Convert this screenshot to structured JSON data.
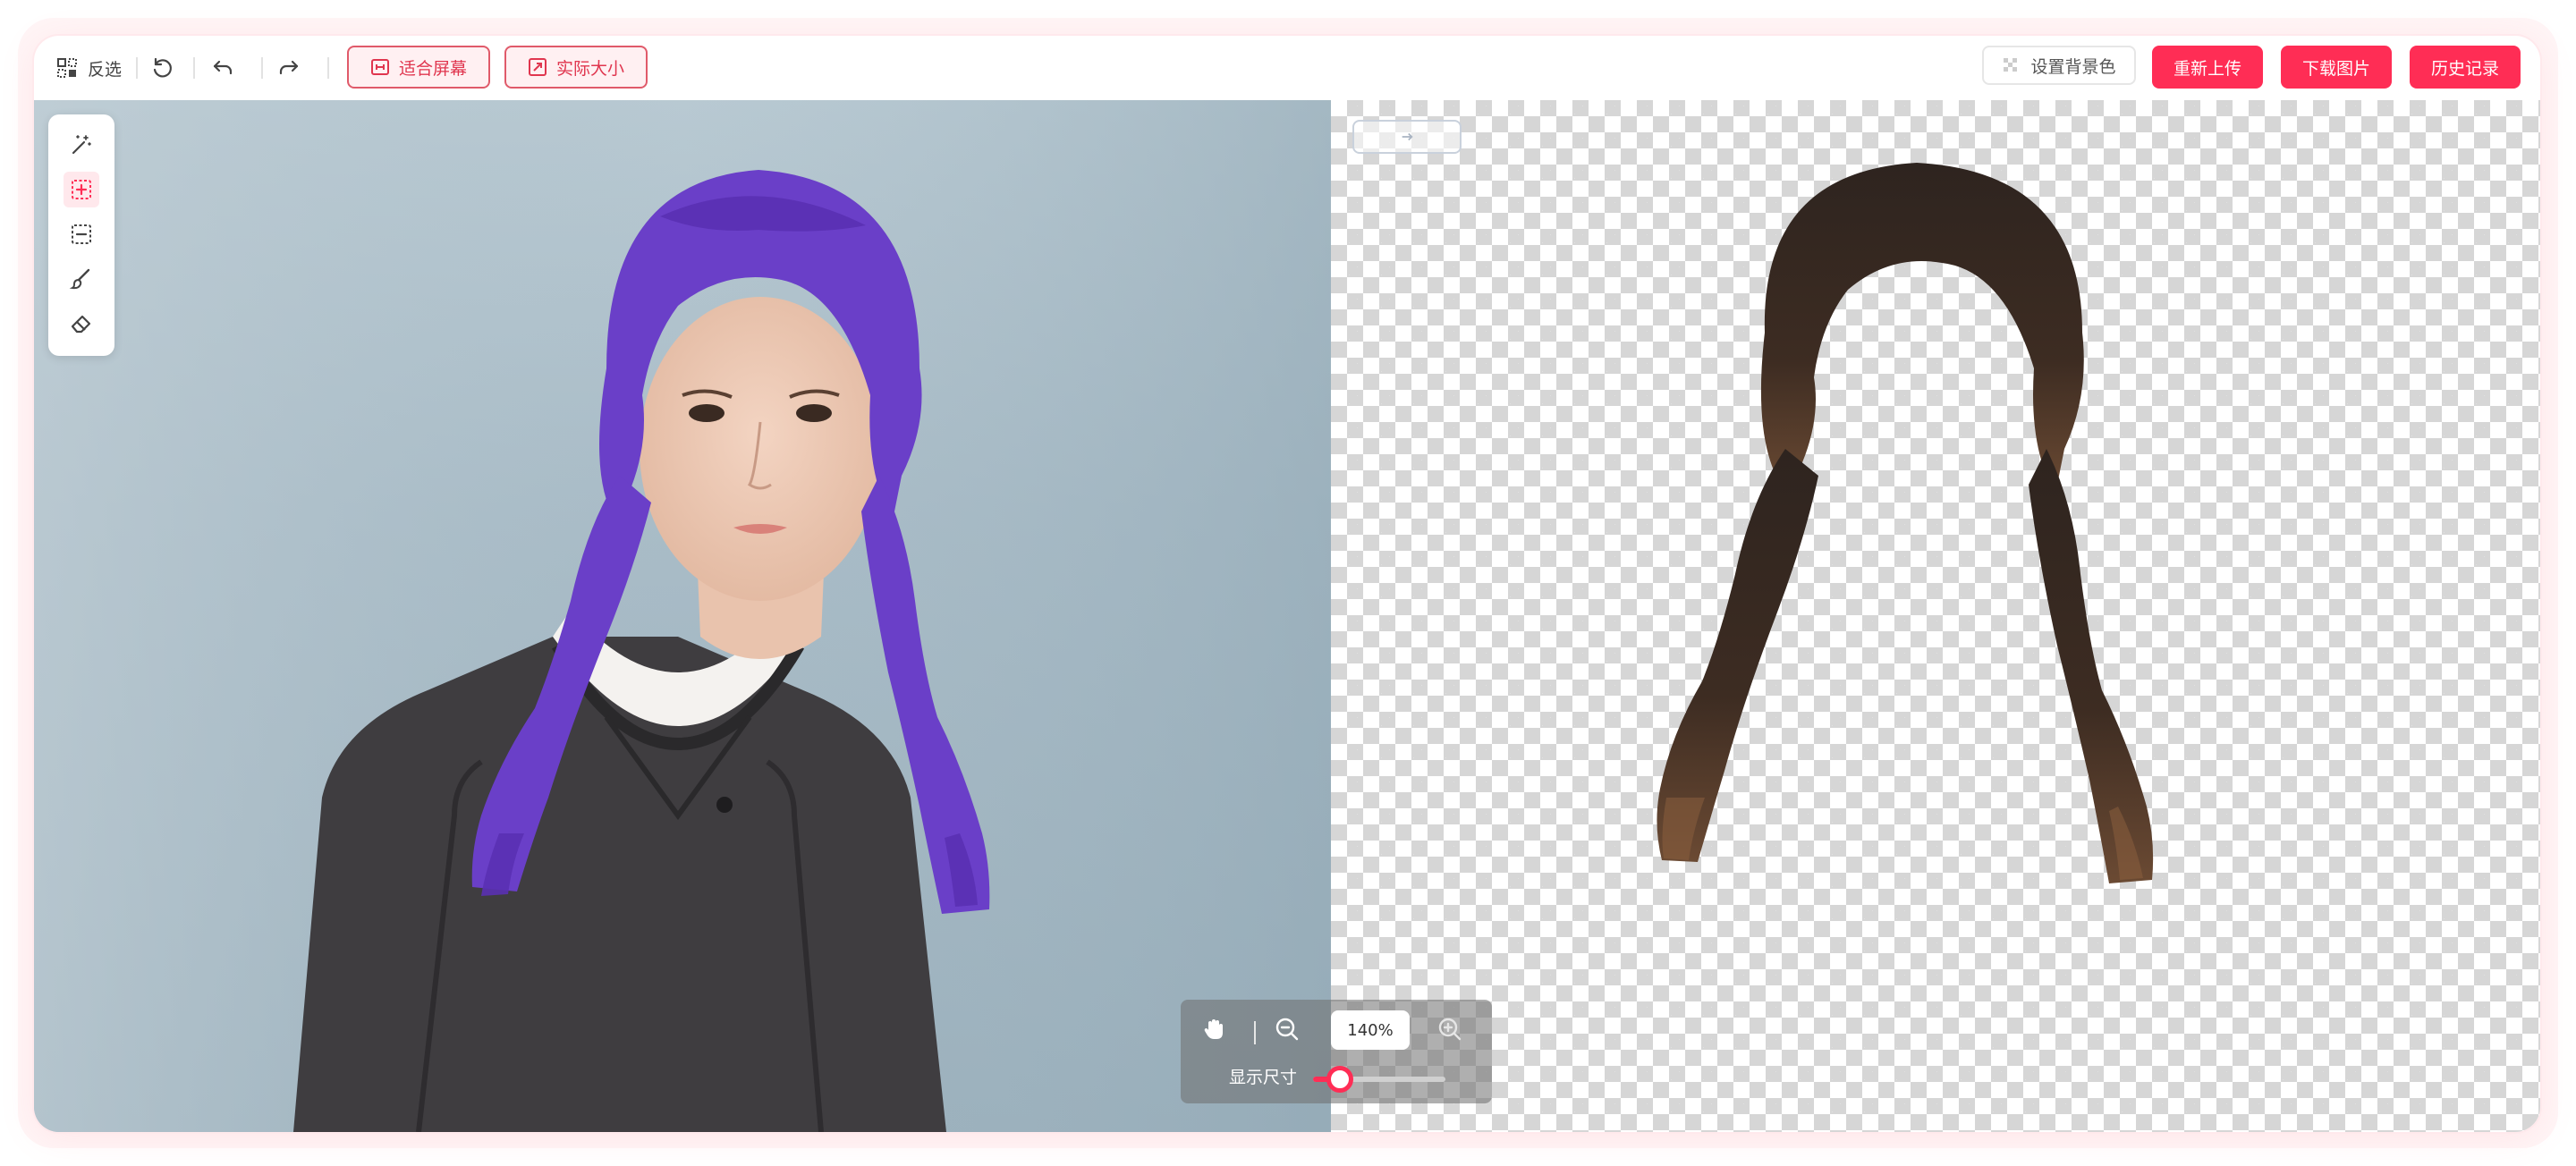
{
  "toolbar": {
    "invert_label": "反选",
    "fit_screen_label": "适合屏幕",
    "actual_size_label": "实际大小",
    "set_bg_label": "设置背景色",
    "reupload_label": "重新上传",
    "download_label": "下载图片",
    "history_label": "历史记录"
  },
  "side_tools": [
    "magic-wand",
    "add-selection",
    "subtract-selection",
    "brush",
    "eraser"
  ],
  "zoom": {
    "value": "140%",
    "display_size_label": "显示尺寸",
    "slider_level_percent": 20
  },
  "colors": {
    "accent": "#ff2d55",
    "accent_border": "#e05a6a",
    "selection_highlight": "#6a3fc8",
    "extracted_hair": "#3b2a20"
  },
  "icons": {
    "invert": "invert-selection-icon",
    "reset": "reset-icon",
    "undo": "undo-icon",
    "redo": "redo-icon",
    "fit": "fit-screen-icon",
    "actual": "actual-size-icon",
    "hand": "hand-icon",
    "zoom_out": "zoom-out-icon",
    "zoom_in": "zoom-in-icon"
  }
}
